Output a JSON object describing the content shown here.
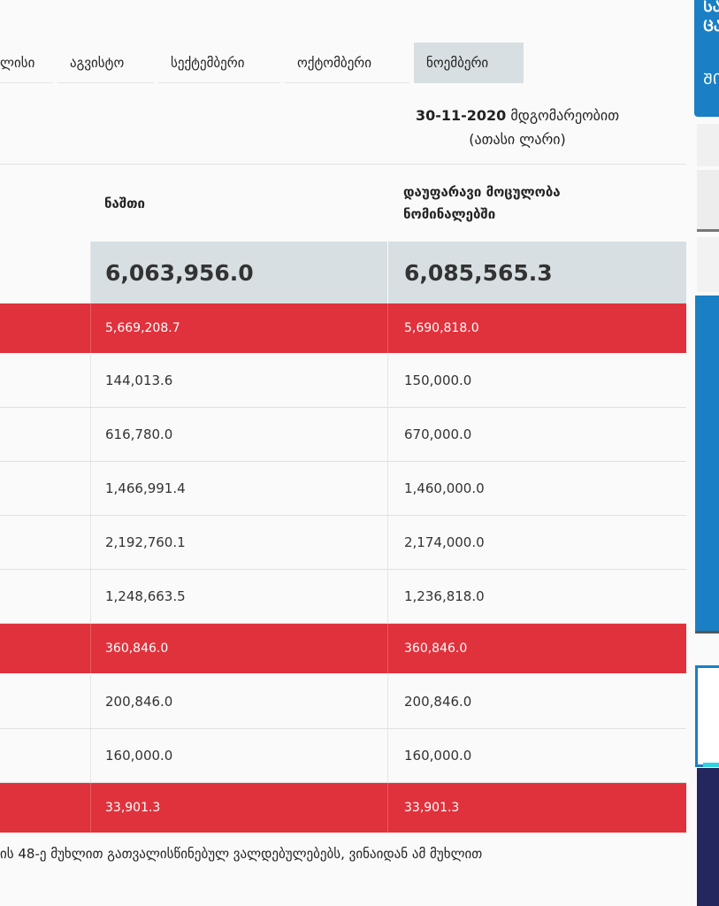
{
  "tabs": [
    {
      "label": "ლისი",
      "active": false
    },
    {
      "label": "აგვისტო",
      "active": false
    },
    {
      "label": "სექტემბერი",
      "active": false
    },
    {
      "label": "ოქტომბერი",
      "active": false
    },
    {
      "label": "ნოემბერი",
      "active": true
    }
  ],
  "header": {
    "date": "30-11-2020",
    "date_suffix": "მდგომარეობით",
    "unit": "(ათასი ლარი)"
  },
  "columns": {
    "balance": "ნაშთი",
    "nominal_line1": "დაუფარავი მოცულობა",
    "nominal_line2": "ნომინალებში"
  },
  "total": {
    "balance": "6,063,956.0",
    "nominal": "6,085,565.3"
  },
  "rows": [
    {
      "balance": "5,669,208.7",
      "nominal": "5,690,818.0",
      "highlight": true
    },
    {
      "balance": "144,013.6",
      "nominal": "150,000.0",
      "highlight": false
    },
    {
      "balance": "616,780.0",
      "nominal": "670,000.0",
      "highlight": false
    },
    {
      "balance": "1,466,991.4",
      "nominal": "1,460,000.0",
      "highlight": false
    },
    {
      "balance": "2,192,760.1",
      "nominal": "2,174,000.0",
      "highlight": false
    },
    {
      "balance": "1,248,663.5",
      "nominal": "1,236,818.0",
      "highlight": false
    },
    {
      "balance": "360,846.0",
      "nominal": "360,846.0",
      "highlight": true
    },
    {
      "balance": "200,846.0",
      "nominal": "200,846.0",
      "highlight": false
    },
    {
      "balance": "160,000.0",
      "nominal": "160,000.0",
      "highlight": false
    },
    {
      "balance": "33,901.3",
      "nominal": "33,901.3",
      "highlight": true
    }
  ],
  "footer_text": "ის 48-ე მუხლით გათვალისწინებულ ვალდებულებებს, ვინაიდან ამ მუხლით",
  "sidebar": {
    "line1": "ᲡᲐ",
    "line2": "ᲪᲐ",
    "line3": "ᲨᲘ"
  },
  "colors": {
    "accent_red": "#e0323c",
    "accent_blue": "#1a7fc4",
    "total_bg": "#d7dfe2"
  }
}
